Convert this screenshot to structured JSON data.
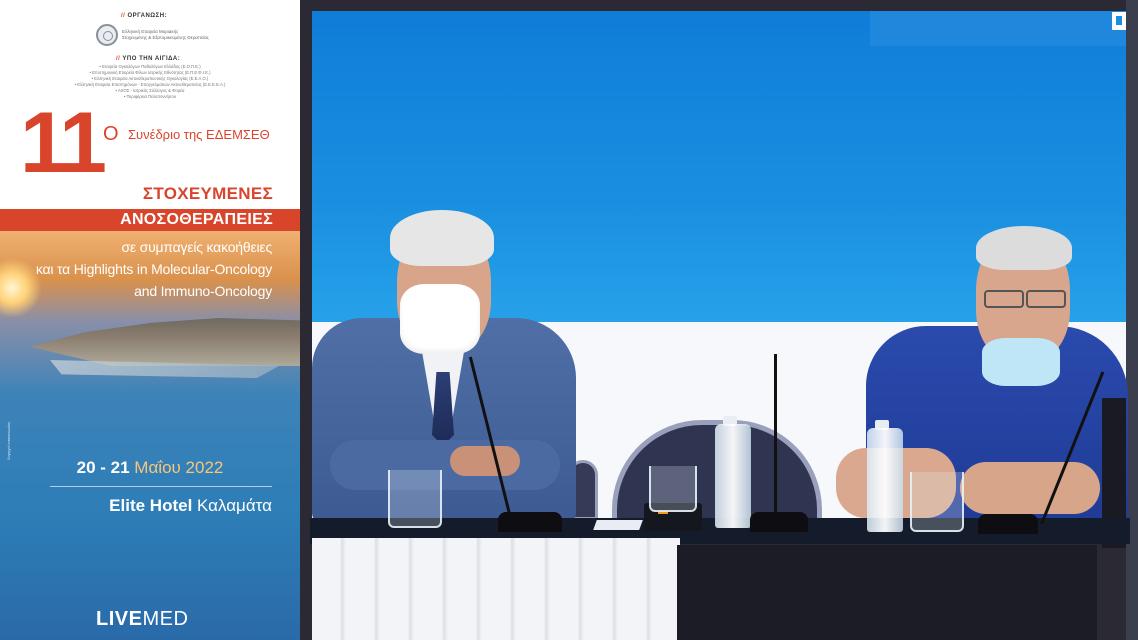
{
  "poster": {
    "organizer_heading_mark": "//",
    "organizer_heading": "ΟΡΓΑΝΩΣΗ:",
    "organizer_lines": [
      "Ελληνική Εταιρεία Μοριακής",
      "Στοχευμένης & Εξατομικευμένης Θεραπείας"
    ],
    "auspices_heading_mark": "//",
    "auspices_heading": "ΥΠΟ ΤΗΝ ΑΙΓΙΔΑ:",
    "auspices_lines": [
      "• Εταιρεία Ογκολόγων Παθολόγων Ελλάδος (Ε.Ο.Π.Ε.)",
      "• Επιστημονική Εταιρεία Φίλων Ιατρικής Εθνότητας (Ε.Π.Ε.Φ.Ι.Ε.)",
      "• Ελληνική Εταιρεία Ακτινοθεραπευτικής Ογκολογίας (Ε.Ε.Α.Ο.)",
      "• Ελληνική Εταιρεία Επιστημόνων - Επαγγελματιών Ακτινοθεραπείας (Ε.Ε.Ε.Ε.Α.)",
      "• ΑΧΟΣ - Ιατρικός Σύλλογος & Φορέα",
      "• Περιφέρεια Πελοποννήσου"
    ],
    "edition_number": "11",
    "edition_suffix": "Ο",
    "congress_name": "Συνέδριο της ΕΔΕΜΣΕΘ",
    "title_line1": "ΣΤΟΧΕΥΜΕΝΕΣ",
    "title_line2": "ΑΝΟΣΟΘΕΡΑΠΕΙΕΣ",
    "subtitle_lines": [
      "σε συμπαγείς κακοήθειες",
      "και τα Highlights in Molecular-Oncology",
      "and Immuno-Oncology"
    ],
    "dates_days": "20 - 21",
    "dates_month": "Μαΐου 2022",
    "venue_name": "Elite Hotel",
    "venue_city": "Καλαμάτα",
    "side_credit": "Χορηγοί επικοινωνίας",
    "brand_bold": "LIVE",
    "brand_light": "MED"
  },
  "colors": {
    "accent": "#d9452b",
    "poster_blue": "#2d7db7",
    "screen_blue": "#1a8fe0"
  },
  "icons": {
    "organizer_logo": "seal-icon",
    "corner_mark": "corner-logo-icon"
  }
}
